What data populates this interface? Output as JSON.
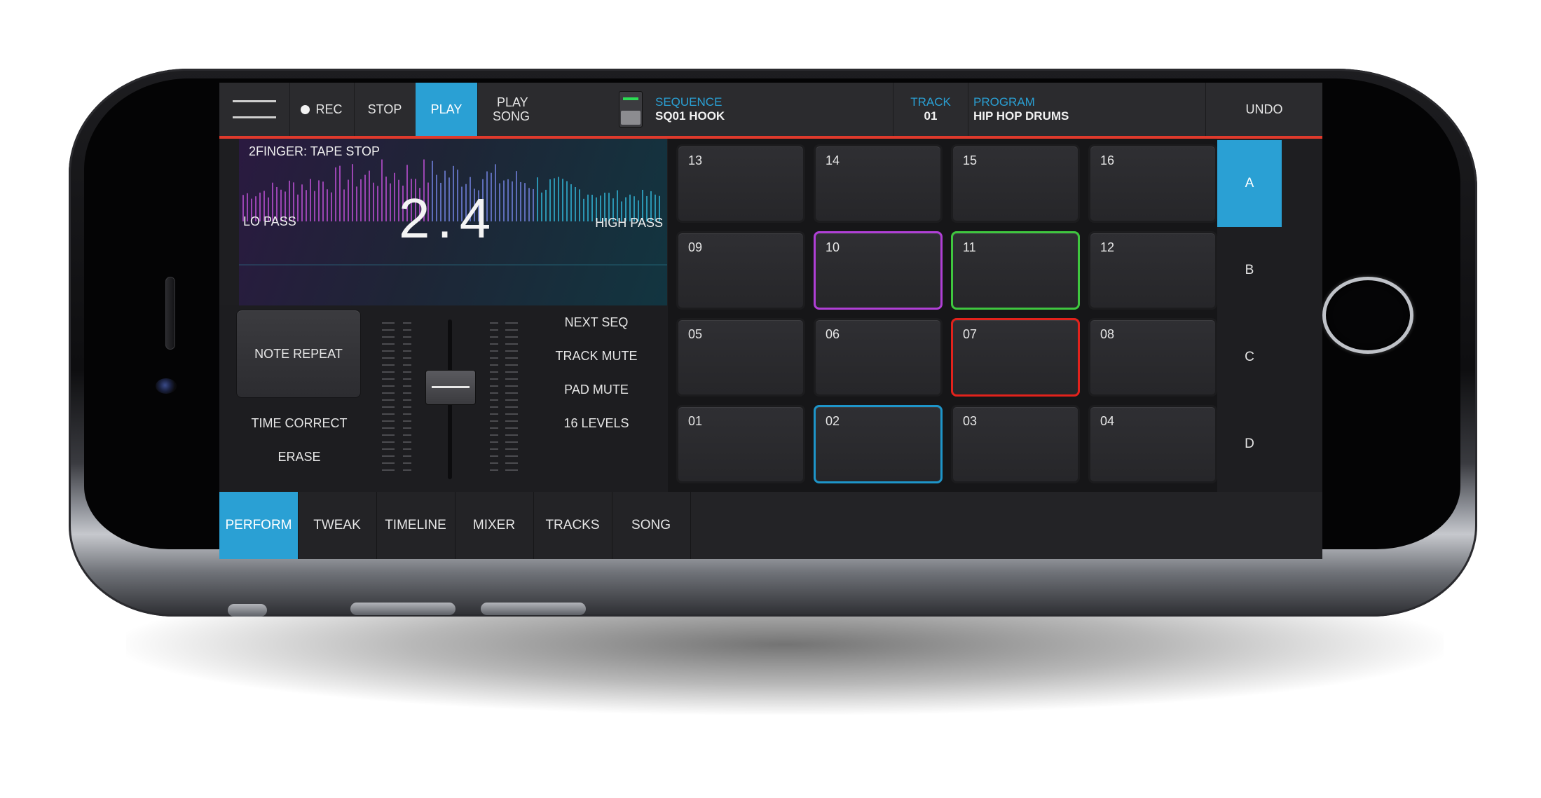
{
  "topbar": {
    "rec_label": "REC",
    "stop_label": "STOP",
    "play_label": "PLAY",
    "play_song_label_1": "PLAY",
    "play_song_label_2": "SONG",
    "sequence_label": "SEQUENCE",
    "sequence_value": "SQ01 HOOK",
    "track_label": "TRACK",
    "track_value": "01",
    "program_label": "PROGRAM",
    "program_value": "HIP HOP DRUMS",
    "undo_label": "UNDO"
  },
  "filter": {
    "title": "2FINGER: TAPE STOP",
    "value": "2.4",
    "left_label": "LO PASS",
    "right_label": "HIGH PASS"
  },
  "controls": {
    "note_repeat": "NOTE REPEAT",
    "time_correct": "TIME CORRECT",
    "erase": "ERASE",
    "next_seq": "NEXT SEQ",
    "track_mute": "TRACK MUTE",
    "pad_mute": "PAD MUTE",
    "levels": "16 LEVELS"
  },
  "pads": [
    {
      "label": "13",
      "highlight": ""
    },
    {
      "label": "14",
      "highlight": ""
    },
    {
      "label": "15",
      "highlight": ""
    },
    {
      "label": "16",
      "highlight": ""
    },
    {
      "label": "09",
      "highlight": ""
    },
    {
      "label": "10",
      "highlight": "purple"
    },
    {
      "label": "11",
      "highlight": "green"
    },
    {
      "label": "12",
      "highlight": ""
    },
    {
      "label": "05",
      "highlight": ""
    },
    {
      "label": "06",
      "highlight": ""
    },
    {
      "label": "07",
      "highlight": "red"
    },
    {
      "label": "08",
      "highlight": ""
    },
    {
      "label": "01",
      "highlight": ""
    },
    {
      "label": "02",
      "highlight": "blue"
    },
    {
      "label": "03",
      "highlight": ""
    },
    {
      "label": "04",
      "highlight": ""
    }
  ],
  "banks": [
    {
      "label": "A",
      "active": true
    },
    {
      "label": "B",
      "active": false
    },
    {
      "label": "C",
      "active": false
    },
    {
      "label": "D",
      "active": false
    }
  ],
  "tabs": [
    {
      "label": "PERFORM",
      "active": true
    },
    {
      "label": "TWEAK",
      "active": false
    },
    {
      "label": "TIMELINE",
      "active": false
    },
    {
      "label": "MIXER",
      "active": false
    },
    {
      "label": "TRACKS",
      "active": false
    },
    {
      "label": "SONG",
      "active": false
    }
  ],
  "colors": {
    "accent": "#2aa0d4",
    "rec_bar": "#e03a2c",
    "pad_purple": "#b03fd6",
    "pad_green": "#3fc63f",
    "pad_red": "#e2221c",
    "pad_blue": "#1e95c9"
  }
}
